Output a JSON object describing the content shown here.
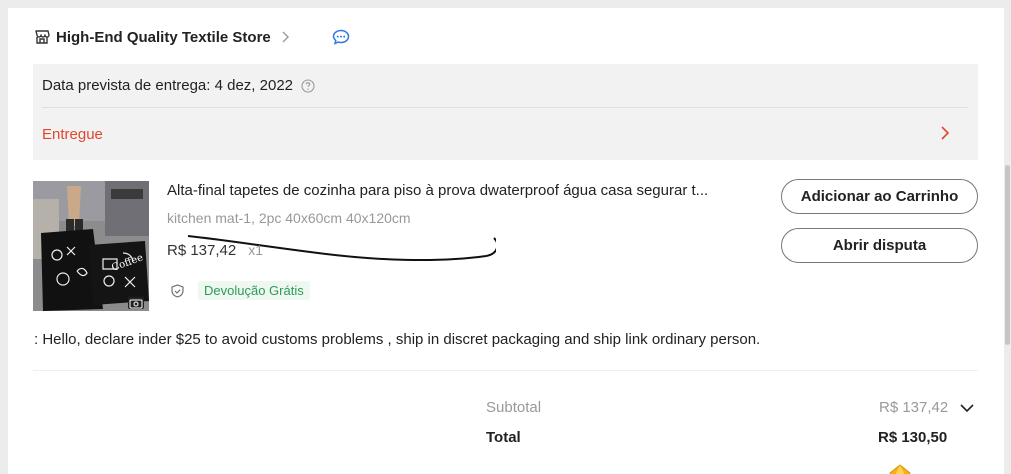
{
  "store": {
    "name": "High-End Quality Textile Store",
    "icons": {
      "store": "store-icon",
      "chevron": "chevron-right-icon",
      "chat": "chat-icon"
    }
  },
  "delivery": {
    "date_text": "Data prevista de entrega: 4 dez, 2022",
    "status": "Entregue",
    "colors": {
      "status": "#e2472d"
    }
  },
  "product": {
    "title": "Alta-final tapetes de cozinha para piso à prova dwaterproof água casa segurar t...",
    "variant": "kitchen mat-1, 2pc 40x60cm 40x120cm",
    "price": "R$ 137,42",
    "qty": "x1",
    "return_badge": "Devolução Grátis",
    "colors": {
      "badge_text": "#2e9a57",
      "badge_bg": "#eef8f1"
    }
  },
  "actions": {
    "add_to_cart": "Adicionar ao Carrinho",
    "open_dispute": "Abrir disputa"
  },
  "note": {
    "text": ": Hello, declare inder $25 to avoid customs problems , ship in discret packaging and ship link ordinary person."
  },
  "summary": {
    "subtotal_label": "Subtotal",
    "subtotal_value": "R$ 137,42",
    "total_label": "Total",
    "total_value": "R$ 130,50"
  }
}
